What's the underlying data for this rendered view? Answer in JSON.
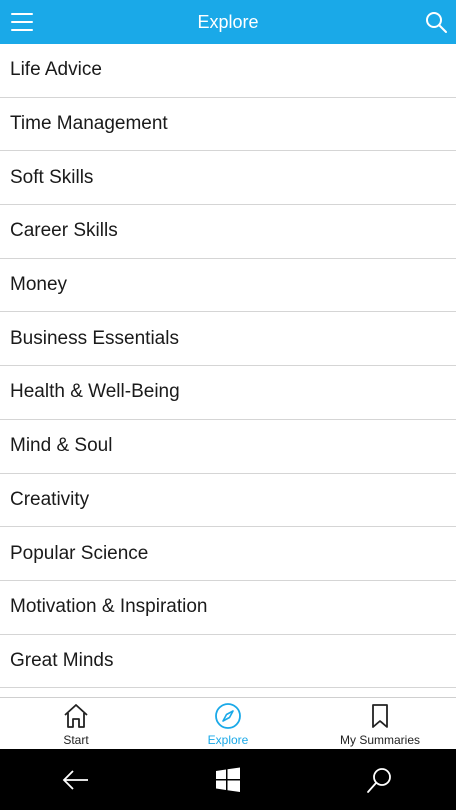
{
  "header": {
    "title": "Explore",
    "menu_icon": "hamburger-icon",
    "search_icon": "search-icon",
    "bar_color": "#1aa9e8"
  },
  "categories": [
    "Life Advice",
    "Time Management",
    "Soft Skills",
    "Career Skills",
    "Money",
    "Business Essentials",
    "Health & Well-Being",
    "Mind & Soul",
    "Creativity",
    "Popular Science",
    "Motivation & Inspiration",
    "Great Minds"
  ],
  "bottom_nav": {
    "items": [
      {
        "label": "Start",
        "icon": "home-icon",
        "active": false
      },
      {
        "label": "Explore",
        "icon": "compass-icon",
        "active": true
      },
      {
        "label": "My Summaries",
        "icon": "bookmark-icon",
        "active": false
      }
    ],
    "active_color": "#1aa9e8"
  },
  "system_bar": {
    "back_icon": "back-arrow-icon",
    "home_icon": "windows-logo-icon",
    "search_icon": "search-icon"
  }
}
